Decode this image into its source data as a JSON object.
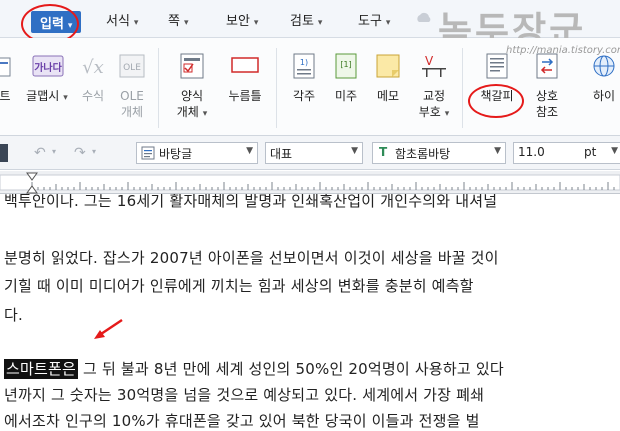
{
  "menu": {
    "items": [
      {
        "label": "입력"
      },
      {
        "label": "서식"
      },
      {
        "label": "쪽"
      },
      {
        "label": "보안"
      },
      {
        "label": "검토"
      },
      {
        "label": "도구"
      }
    ]
  },
  "watermark": {
    "text": "녹두장군",
    "url": "http://mania.tistory.com"
  },
  "ribbon": {
    "items": [
      {
        "label": "트"
      },
      {
        "label": "글맵시"
      },
      {
        "label": "수식"
      },
      {
        "label": "OLE"
      },
      {
        "label": "개체"
      },
      {
        "label": "양식"
      },
      {
        "label": "개체"
      },
      {
        "label": "누름틀"
      },
      {
        "label": "각주"
      },
      {
        "label": "미주"
      },
      {
        "label": "메모"
      },
      {
        "label": "교정"
      },
      {
        "label": "부호"
      },
      {
        "label": "책갈피"
      },
      {
        "label": "상호"
      },
      {
        "label": "참조"
      },
      {
        "label": "하이"
      }
    ],
    "icons": {
      "wordart": "가나다",
      "formula": "√x",
      "ole": "OLE",
      "endnote": "[1]"
    }
  },
  "format": {
    "style": "바탕글",
    "language": "대표",
    "font": "함초롬바탕",
    "font_icon": "T",
    "size": "11.0",
    "unit": "pt"
  },
  "doc": {
    "lines": [
      "백투안이나. 그는 16세기 활자매체의 발명과 인쇄혹산업이 개인수의와 내셔널",
      "분명히 읽었다. 잡스가 2007년 아이폰을 선보이면서 이것이 세상을 바꿀 것이",
      "기힐 때 이미 미디어가 인류에게 끼치는 힘과 세상의 변화를 충분히 예측할",
      "다.",
      "스마트폰은",
      " 그 뒤 불과 8년 만에 세계 성인의 50%인 20억명이 사용하고 있다",
      "년까지 그 숫자는 30억명을 넘을 것으로 예상되고 있다. 세계에서 가장 폐쇄",
      "에서조차 인구의 10%가 휴대폰을 갖고 있어 북한 당국이 이들과 전쟁을 벌"
    ]
  }
}
